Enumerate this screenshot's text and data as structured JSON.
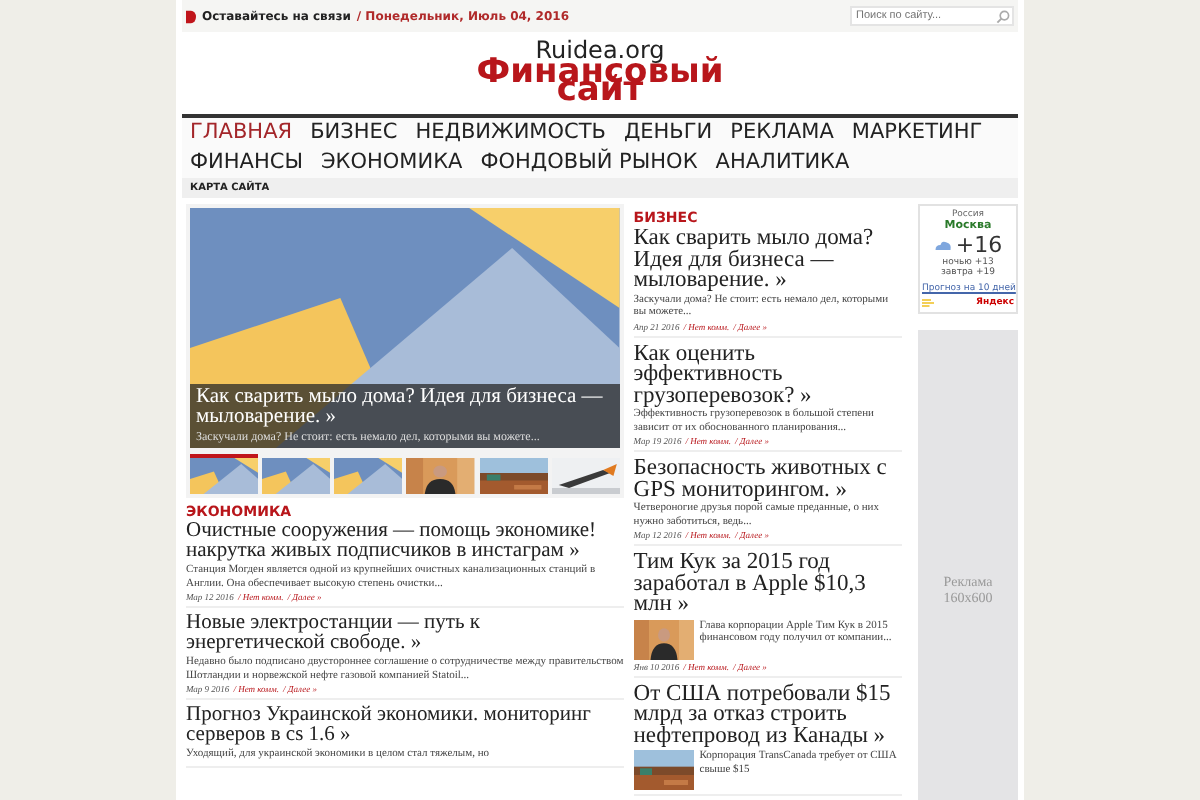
{
  "top_bar": {
    "contact": "Оставайтесь на связи",
    "date": "/ Понедельник, Июль 04, 2016",
    "search": {
      "placeholder": "Поиск по сайту..."
    }
  },
  "header": {
    "site": "Ruidea.org",
    "title": "Финансовый сайт"
  },
  "nav": [
    {
      "label": "ГЛАВНАЯ",
      "selected": true
    },
    {
      "label": "БИЗНЕС",
      "selected": false
    },
    {
      "label": "НЕДВИЖИМОСТЬ",
      "selected": false
    },
    {
      "label": "ДЕНЬГИ",
      "selected": false
    },
    {
      "label": "РЕКЛАМА",
      "selected": false
    },
    {
      "label": "МАРКЕТИНГ",
      "selected": false
    },
    {
      "label": "ФИНАНСЫ",
      "selected": false
    },
    {
      "label": "ЭКОНОМИКА",
      "selected": false
    },
    {
      "label": "ФОНДОВЫЙ РЫНОК",
      "selected": false
    },
    {
      "label": "АНАЛИТИКА",
      "selected": false
    }
  ],
  "sub_nav": [
    "КАРТА САЙТА"
  ],
  "slider": {
    "title": "Как сварить мыло дома? Идея для бизнеса — мыловарение. »",
    "excerpt": "Заскучали дома? Не стоит: есть немало дел, которыми вы можете...",
    "thumbnails": [
      {
        "kind": "picture",
        "selected": true
      },
      {
        "kind": "picture",
        "selected": false
      },
      {
        "kind": "picture",
        "selected": false
      },
      {
        "kind": "picture",
        "selected": false
      },
      {
        "kind": "picture",
        "selected": false
      },
      {
        "kind": "picture",
        "selected": false
      }
    ]
  },
  "economy": {
    "heading": "ЭКОНОМИКА",
    "articles": [
      {
        "title": "Очистные сооружения — помощь экономике! накрутка живых подписчиков в инстаграм »",
        "excerpt": "Станция Могден является одной из крупнейших очистных канализационных станций в Англии. Она обеспечивает высокую степень очистки...",
        "date": "Мар 12 2016",
        "comments": "/ Нет комм.",
        "more": "/ Далее »"
      },
      {
        "title": "Новые электростанции — путь к энергетической свободе. »",
        "excerpt": "Недавно было подписано двустороннее соглашение о сотрудничестве между правительством Шотландии и норвежской нефте газовой компанией Statoil...",
        "date": "Мар 9 2016",
        "comments": "/ Нет комм.",
        "more": "/ Далее »"
      },
      {
        "title": "Прогноз Украинской экономики. мониторинг серверов в cs 1.6 »",
        "excerpt": "Уходящий, для украинской экономики в целом стал тяжелым, но"
      }
    ]
  },
  "business": {
    "heading": "БИЗНЕС",
    "articles": [
      {
        "kind": "text",
        "title": "Как сварить мыло дома? Идея для бизнеса — мыловарение. »",
        "excerpt": "Заскучали дома? Не стоит: есть немало дел, которыми вы можете...",
        "date": "Апр 21 2016",
        "comments": "/ Нет комм.",
        "more": "/ Далее »"
      },
      {
        "kind": "text",
        "title": "Как оценить эффективность грузоперевозок? »",
        "excerpt": "Эффективность грузоперевозок в большой степени зависит от их обоснованного планирования...",
        "date": "Мар 19 2016",
        "comments": "/ Нет комм.",
        "more": "/ Далее »"
      },
      {
        "kind": "text",
        "title": "Безопасность животных с GPS мониторингом. »",
        "excerpt": "Четвероногие друзья порой самые преданные, о них нужно заботиться, ведь...",
        "date": "Мар 12 2016",
        "comments": "/ Нет комм.",
        "more": "/ Далее »"
      },
      {
        "kind": "thumb",
        "title": "Тим Кук за 2015 год заработал в Apple $10,3 млн »",
        "excerpt": "Глава корпорации Apple Тим Кук в 2015 финансовом году получил от компании...",
        "date": "Янв 10 2016",
        "comments": "/ Нет комм.",
        "more": "/ Далее »"
      },
      {
        "kind": "thumb",
        "title": "От США потребовали $15 млрд за отказ строить нефтепровод из Канады »",
        "excerpt": "Корпорация TransCanada требует от США свыше $15"
      }
    ]
  },
  "weather": {
    "region": "Россия",
    "city": "Москва",
    "temp": "+16",
    "night": "ночью +13",
    "tomorrow": "завтра +19",
    "link": "Прогноз на 10 дней",
    "logo": "Яндекс"
  },
  "ad": {
    "text": "Реклама 160x600"
  }
}
